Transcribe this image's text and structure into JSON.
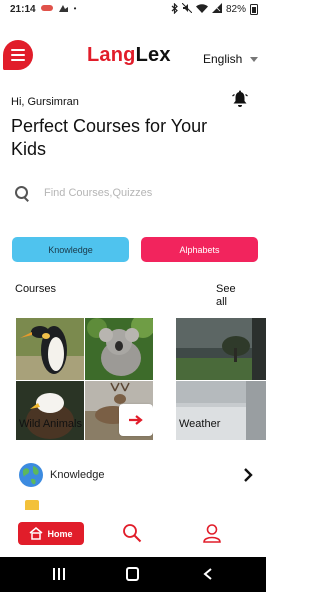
{
  "status_bar": {
    "time": "21:14",
    "battery": "82%"
  },
  "header": {
    "logo_part1": "Lang",
    "logo_part2": "Lex",
    "language": "English"
  },
  "greeting": "Hi, Gursimran",
  "headline": "Perfect Courses for Your Kids",
  "search": {
    "placeholder": "Find Courses,Quizzes"
  },
  "categories": [
    {
      "label": "Knowledge",
      "color": "#4fc3ee"
    },
    {
      "label": "Alphabets",
      "color": "#f2245d"
    }
  ],
  "courses_section": {
    "title": "Courses",
    "see_all": "See all"
  },
  "courses": [
    {
      "label": "Wild Animals"
    },
    {
      "label": "Weather"
    }
  ],
  "knowledge_row": {
    "label": "Knowledge"
  },
  "bottom_nav": {
    "home_label": "Home"
  },
  "colors": {
    "brand": "#e11d2a",
    "knowledge": "#4fc3ee",
    "alphabets": "#f2245d"
  }
}
